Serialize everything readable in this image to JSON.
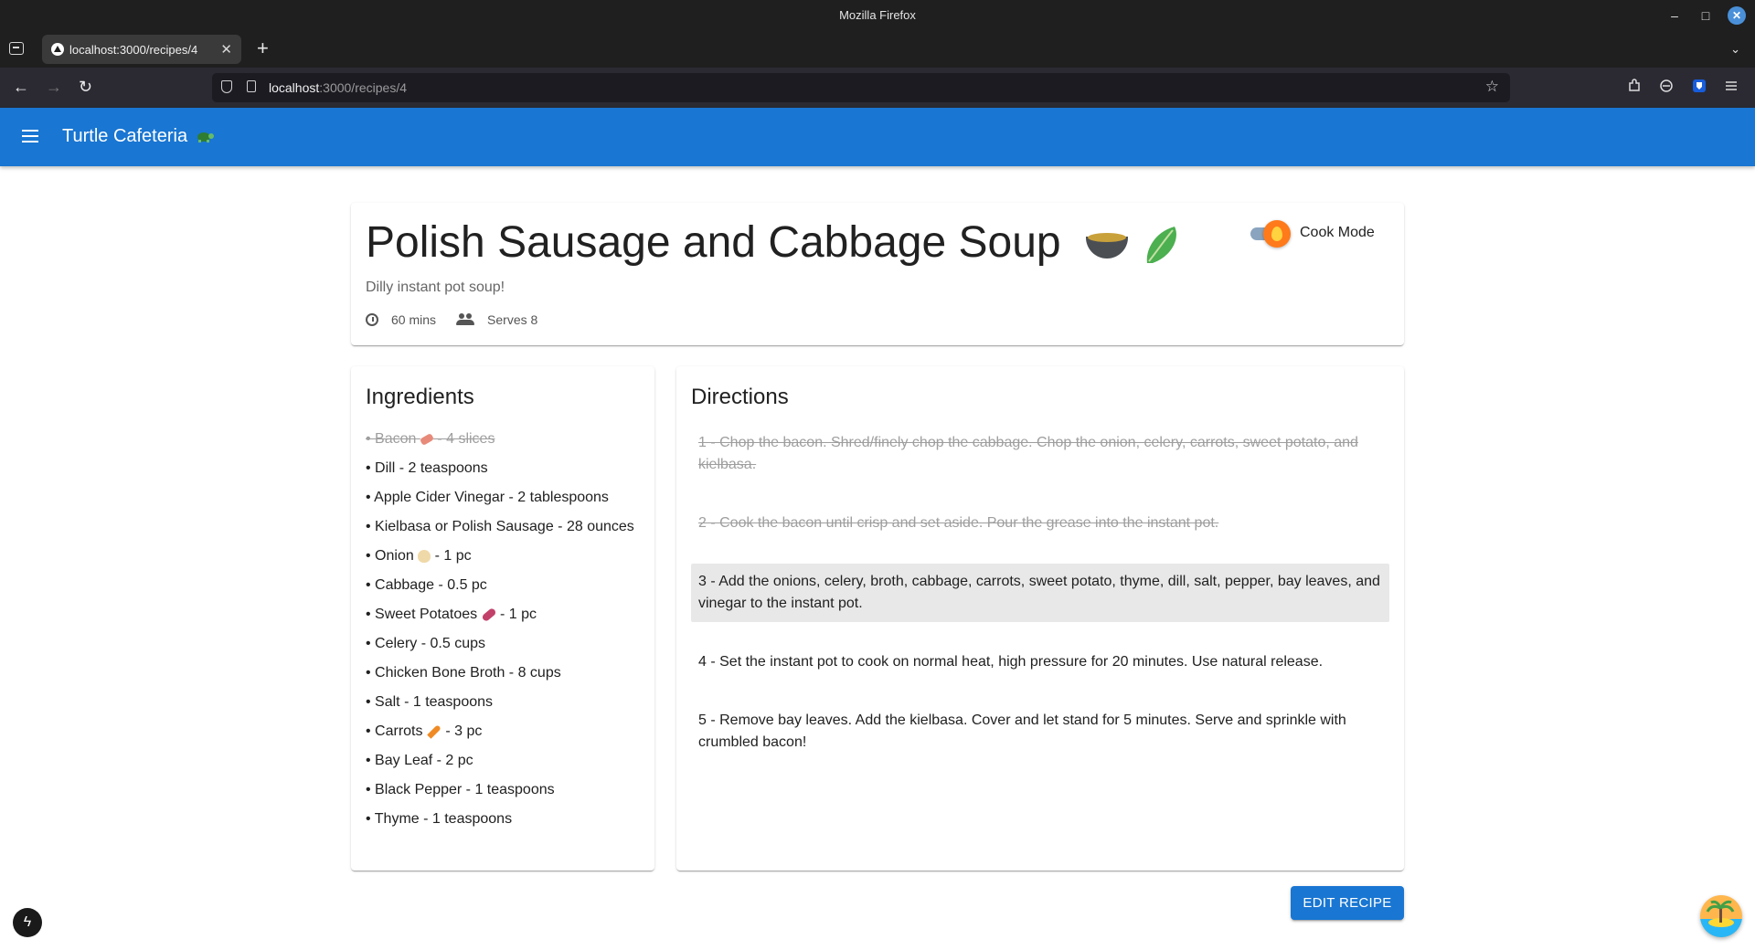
{
  "browser": {
    "window_title": "Mozilla Firefox",
    "tab_label": "localhost:3000/recipes/4",
    "tab_close": "✕",
    "new_tab": "+",
    "url_host": "localhost",
    "url_rest": ":3000/recipes/4"
  },
  "app": {
    "title": "Turtle Cafeteria"
  },
  "recipe": {
    "title": "Polish Sausage and Cabbage Soup",
    "subtitle": "Dilly instant pot soup!",
    "time": "60 mins",
    "serves": "Serves 8",
    "cook_mode_label": "Cook Mode"
  },
  "ingredients": {
    "heading": "Ingredients",
    "items": [
      {
        "name": "Bacon",
        "amount": "4 slices",
        "done": true,
        "icon": "bacon-icon"
      },
      {
        "name": "Dill",
        "amount": "2 teaspoons"
      },
      {
        "name": "Apple Cider Vinegar",
        "amount": "2 tablespoons"
      },
      {
        "name": "Kielbasa or Polish Sausage",
        "amount": "28 ounces"
      },
      {
        "name": "Onion",
        "amount": "1 pc",
        "icon": "onion-icon"
      },
      {
        "name": "Cabbage",
        "amount": "0.5 pc"
      },
      {
        "name": "Sweet Potatoes",
        "amount": "1 pc",
        "icon": "sweet-potato-icon"
      },
      {
        "name": "Celery",
        "amount": "0.5 cups"
      },
      {
        "name": "Chicken Bone Broth",
        "amount": "8 cups"
      },
      {
        "name": "Salt",
        "amount": "1 teaspoons"
      },
      {
        "name": "Carrots",
        "amount": "3 pc",
        "icon": "carrot-icon"
      },
      {
        "name": "Bay Leaf",
        "amount": "2 pc"
      },
      {
        "name": "Black Pepper",
        "amount": "1 teaspoons"
      },
      {
        "name": "Thyme",
        "amount": "1 teaspoons"
      }
    ]
  },
  "directions": {
    "heading": "Directions",
    "steps": [
      {
        "text": "1 - Chop the bacon. Shred/finely chop the cabbage. Chop the onion, celery, carrots, sweet potato, and kielbasa.",
        "state": "done"
      },
      {
        "text": "2 - Cook the bacon until crisp and set aside. Pour the grease into the instant pot.",
        "state": "done"
      },
      {
        "text": "3 - Add the onions, celery, broth, cabbage, carrots, sweet potato, thyme, dill, salt, pepper, bay leaves, and vinegar to the instant pot.",
        "state": "active"
      },
      {
        "text": "4 - Set the instant pot to cook on normal heat, high pressure for 20 minutes. Use natural release.",
        "state": "todo"
      },
      {
        "text": "5 - Remove bay leaves. Add the kielbasa. Cover and let stand for 5 minutes. Serve and sprinkle with crumbled bacon!",
        "state": "todo"
      }
    ]
  },
  "actions": {
    "edit_label": "EDIT RECIPE"
  },
  "colors": {
    "primary": "#1976d2",
    "done_text": "#9e9e9e",
    "active_step_bg": "#e8e8e8"
  }
}
